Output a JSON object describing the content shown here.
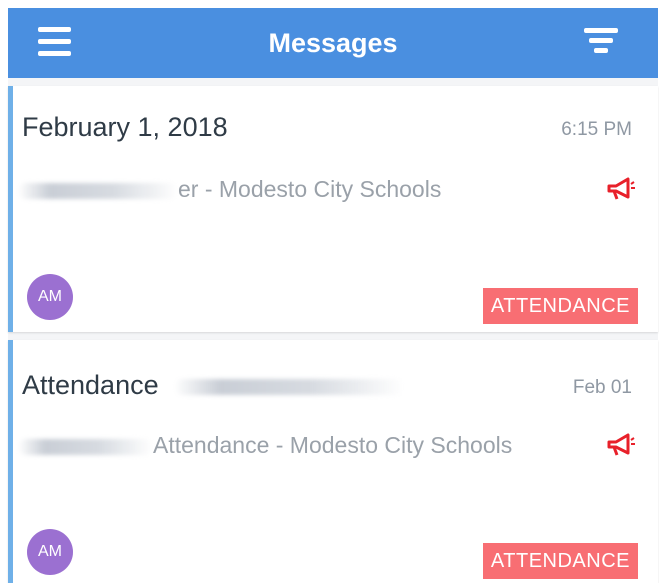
{
  "header": {
    "title": "Messages",
    "menu_icon": "hamburger-menu-icon",
    "filter_icon": "filter-icon",
    "color": "#4a8fe0"
  },
  "messages": [
    {
      "title": "February 1, 2018",
      "time": "6:15 PM",
      "sender_suffix": "er - Modesto City Schools",
      "avatar_initials": "AM",
      "badge": "ATTENDANCE",
      "icon": "megaphone-icon"
    },
    {
      "title": "Attendance",
      "time": "Feb 01",
      "sender_suffix": "Attendance - Modesto City Schools",
      "avatar_initials": "AM",
      "badge": "ATTENDANCE",
      "icon": "megaphone-icon"
    }
  ],
  "colors": {
    "accent_bar": "#6fb0e8",
    "avatar": "#9b70d1",
    "badge": "#f86e73",
    "megaphone": "#e8202a"
  }
}
